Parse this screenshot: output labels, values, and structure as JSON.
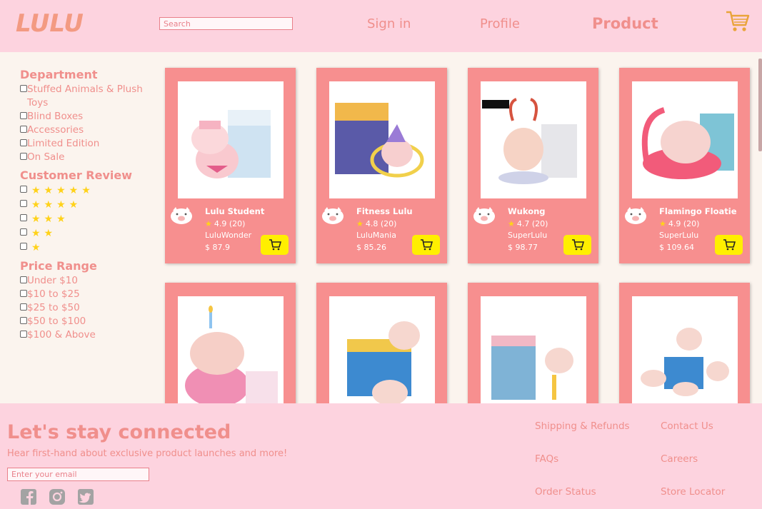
{
  "header": {
    "logo_text": "LULU",
    "search_placeholder": "Search",
    "nav": [
      "Sign in",
      "Profile",
      "Product"
    ],
    "cart_icon": "cart-icon"
  },
  "sidebar": {
    "department_title": "Department",
    "departments": [
      "Stuffed Animals & Plush Toys",
      "Blind Boxes",
      "Accessories",
      "Limited Edition",
      "On Sale"
    ],
    "review_title": "Customer Review",
    "review_stars": [
      5,
      4,
      3,
      2,
      1
    ],
    "price_title": "Price Range",
    "prices": [
      "Under $10",
      "$10 to $25",
      "$25 to $50",
      "$50 to $100",
      "$100 & Above"
    ]
  },
  "products": [
    {
      "name": "Lulu Student",
      "rating": "4.9 (20)",
      "seller": "LuluWonder",
      "price": "$ 87.9"
    },
    {
      "name": "Fitness Lulu",
      "rating": "4.8 (20)",
      "seller": "LuluMania",
      "price": "$ 85.26"
    },
    {
      "name": "Wukong",
      "rating": "4.7 (20)",
      "seller": "SuperLulu",
      "price": "$ 98.77"
    },
    {
      "name": "Flamingo Floatie",
      "rating": "4.9 (20)",
      "seller": "SuperLulu",
      "price": "$ 109.64"
    }
  ],
  "footer": {
    "title": "Let's stay connected",
    "subtitle": "Hear first-hand about exclusive product launches and more!",
    "email_placeholder": "Enter your email",
    "links": [
      "Shipping & Refunds",
      "Contact Us",
      "FAQs",
      "Careers",
      "Order Status",
      "Store Locator"
    ],
    "social_icons": [
      "facebook-icon",
      "instagram-icon",
      "twitter-icon"
    ]
  },
  "colors": {
    "accent": "#f08f8c",
    "card": "#f78f8f",
    "header_bg": "#fdd3df",
    "button": "#ffef00",
    "star": "#ffd21a"
  }
}
